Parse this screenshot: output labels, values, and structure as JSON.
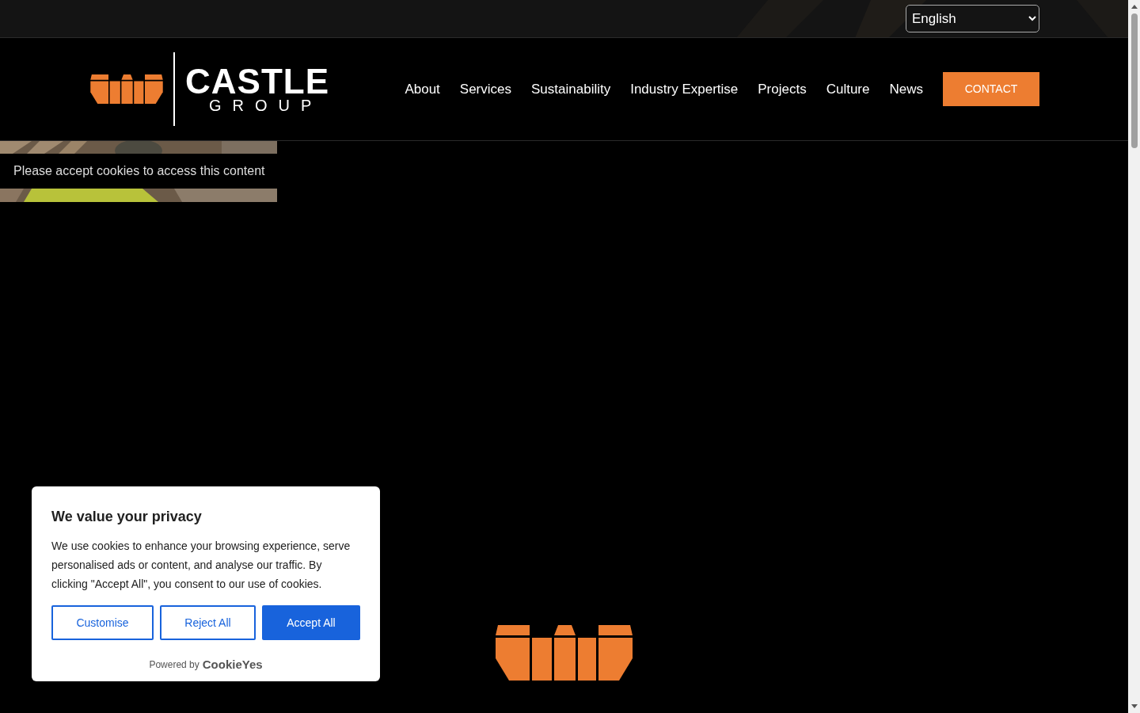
{
  "language_select": {
    "value": "English"
  },
  "logo": {
    "name": "CASTLE",
    "subtitle": "GROUP"
  },
  "nav": {
    "items": [
      "About",
      "Services",
      "Sustainability",
      "Industry Expertise",
      "Projects",
      "Culture",
      "News"
    ],
    "cta": "CONTACT"
  },
  "embed": {
    "kind": "picture",
    "notice": "Please accept cookies to access this content"
  },
  "cookie_banner": {
    "title": "We value your privacy",
    "body": "We use cookies to enhance your browsing experience, serve personalised ads or content, and analyse our traffic. By clicking \"Accept All\", you consent to our use of cookies.",
    "buttons": [
      {
        "label": "Customise",
        "kind": "outline"
      },
      {
        "label": "Reject All",
        "kind": "outline"
      },
      {
        "label": "Accept All",
        "kind": "primary"
      }
    ],
    "powered_by": "Powered by",
    "brand": "CookieYes"
  }
}
